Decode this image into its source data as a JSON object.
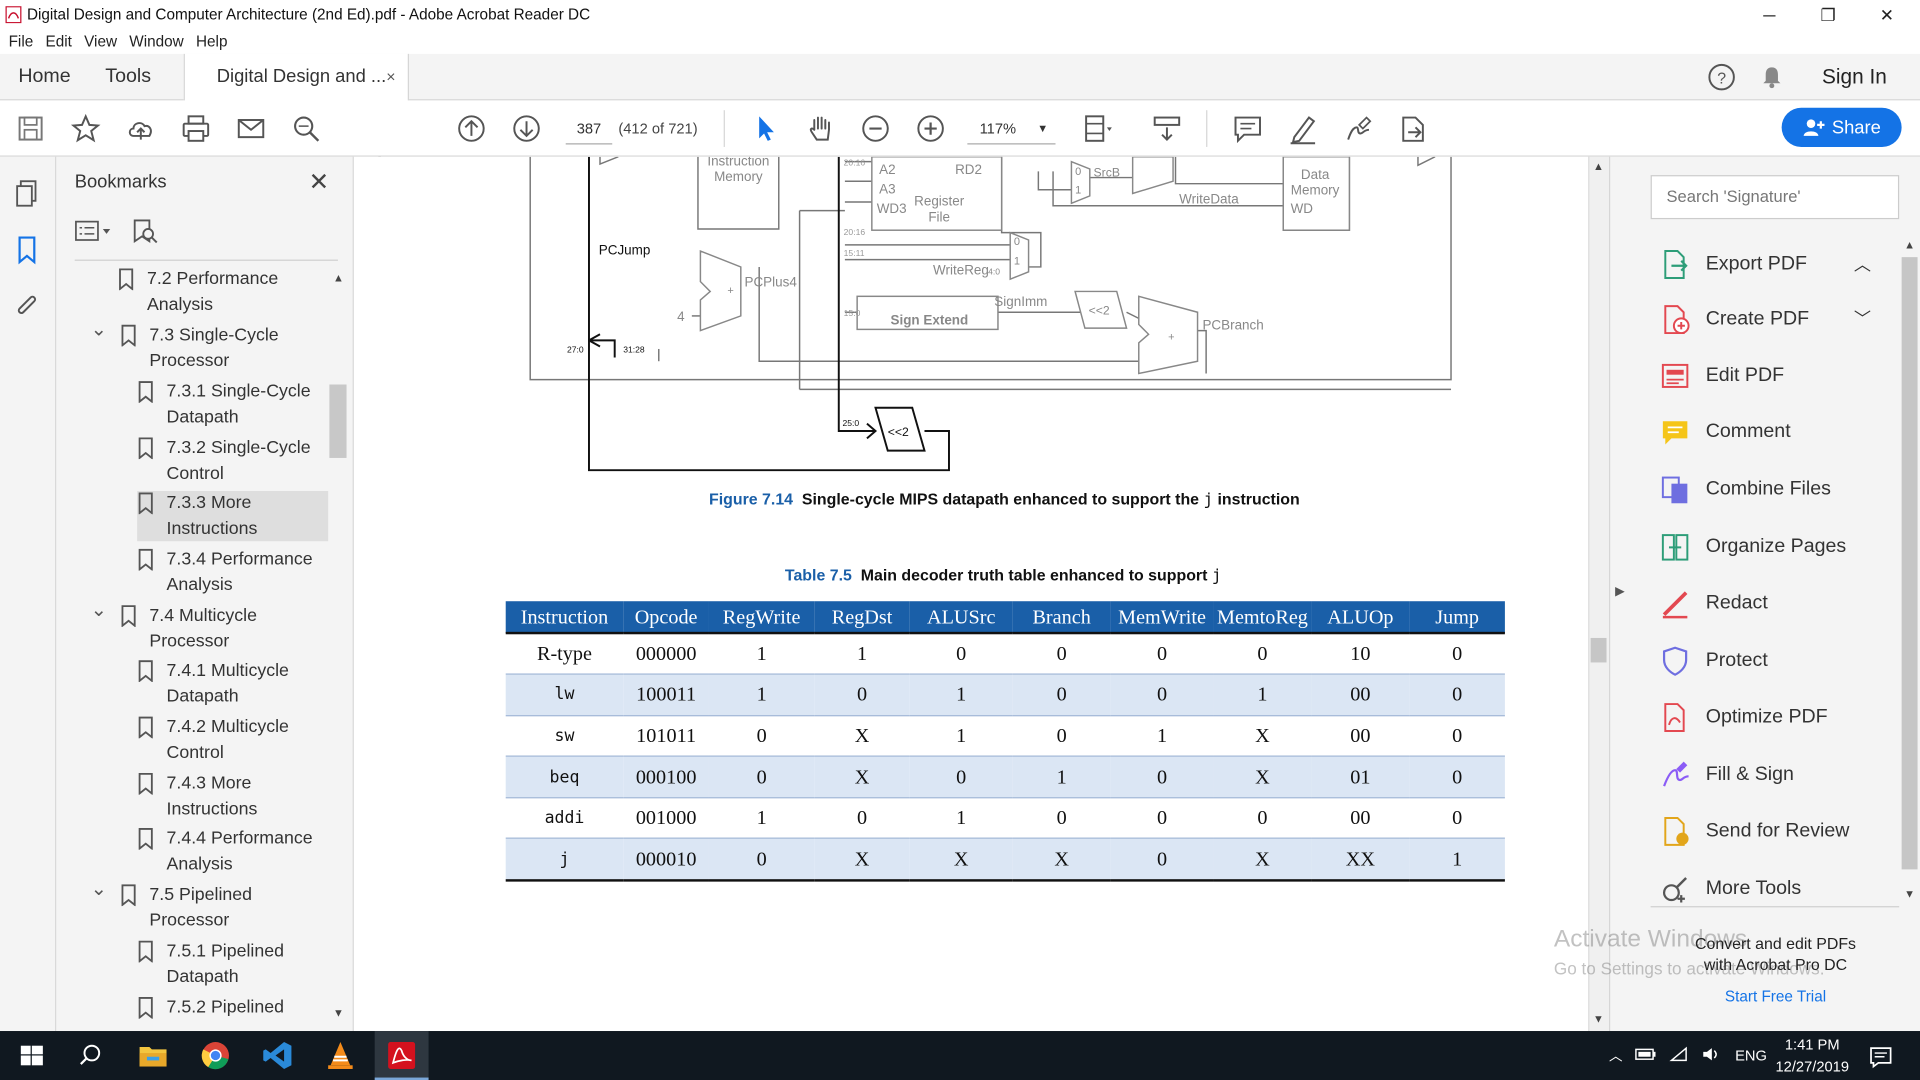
{
  "window": {
    "title": "Digital Design and Computer Architecture (2nd Ed).pdf - Adobe Acrobat Reader DC",
    "minimize": "─",
    "restore": "❐",
    "close": "✕"
  },
  "menu": [
    "File",
    "Edit",
    "View",
    "Window",
    "Help"
  ],
  "tabs": {
    "home": "Home",
    "tools": "Tools",
    "document": "Digital Design and ...",
    "document_close": "×",
    "sign_in": "Sign In"
  },
  "toolbar": {
    "page_number": "387",
    "page_count": "(412 of 721)",
    "zoom": "117%",
    "share_label": "Share"
  },
  "bookmarks": {
    "title": "Bookmarks",
    "close": "✕",
    "items": [
      {
        "label_line1": "7.2 Performance",
        "label_line2": "Analysis"
      },
      {
        "label_line1": "7.3 Single-Cycle",
        "label_line2": "Processor"
      },
      {
        "label_line1": "7.3.1 Single-Cycle",
        "label_line2": "Datapath"
      },
      {
        "label_line1": "7.3.2 Single-Cycle",
        "label_line2": "Control"
      },
      {
        "label_line1": "7.3.3 More",
        "label_line2": "Instructions"
      },
      {
        "label_line1": "7.3.4 Performance",
        "label_line2": "Analysis"
      },
      {
        "label_line1": "7.4 Multicycle",
        "label_line2": "Processor"
      },
      {
        "label_line1": "7.4.1 Multicycle",
        "label_line2": "Datapath"
      },
      {
        "label_line1": "7.4.2 Multicycle",
        "label_line2": "Control"
      },
      {
        "label_line1": "7.4.3 More",
        "label_line2": "Instructions"
      },
      {
        "label_line1": "7.4.4 Performance",
        "label_line2": "Analysis"
      },
      {
        "label_line1": "7.5 Pipelined",
        "label_line2": "Processor"
      },
      {
        "label_line1": "7.5.1 Pipelined",
        "label_line2": "Datapath"
      },
      {
        "label_line1": "7.5.2 Pipelined",
        "label_line2": ""
      }
    ]
  },
  "diagram": {
    "instruction_memory": [
      "Instruction",
      "Memory"
    ],
    "register_file": [
      "Register",
      "File"
    ],
    "data_memory": [
      "Data",
      "Memory"
    ],
    "reg_ports": [
      "A2",
      "A3",
      "WD3"
    ],
    "rd2": "RD2",
    "wd": "WD",
    "srcb": "SrcB",
    "writedata": "WriteData",
    "writereg": "WriteReg",
    "writereg_sub": "4:0",
    "pcplus4": "PCPlus4",
    "pcjump": "PCJump",
    "four": "4",
    "plus": "+",
    "sign_extend": "Sign Extend",
    "signimm": "SignImm",
    "shift_left": "<<2",
    "pcbranch": "PCBranch",
    "bits_20_16": "20:16",
    "bits_15_11": "15:11",
    "bits_15_0": "15:0",
    "bits_27_0": "27:0",
    "bits_31_28": "31:28",
    "bits_25_0": "25:0",
    "mux0": "0",
    "mux1": "1"
  },
  "figure": {
    "label": "Figure 7.14",
    "text": "Single-cycle MIPS datapath enhanced to support the",
    "mono": "j",
    "tail": "instruction"
  },
  "table_caption": {
    "label": "Table 7.5",
    "text": "Main decoder truth table enhanced to support",
    "mono": "j"
  },
  "truth_table": {
    "headers": [
      "Instruction",
      "Opcode",
      "RegWrite",
      "RegDst",
      "ALUSrc",
      "Branch",
      "MemWrite",
      "MemtoReg",
      "ALUOp",
      "Jump"
    ],
    "rows": [
      [
        "R-type",
        "000000",
        "1",
        "1",
        "0",
        "0",
        "0",
        "0",
        "10",
        "0"
      ],
      [
        "lw",
        "100011",
        "1",
        "0",
        "1",
        "0",
        "0",
        "1",
        "00",
        "0"
      ],
      [
        "sw",
        "101011",
        "0",
        "X",
        "1",
        "0",
        "1",
        "X",
        "00",
        "0"
      ],
      [
        "beq",
        "000100",
        "0",
        "X",
        "0",
        "1",
        "0",
        "X",
        "01",
        "0"
      ],
      [
        "addi",
        "001000",
        "1",
        "0",
        "1",
        "0",
        "0",
        "0",
        "00",
        "0"
      ],
      [
        "j",
        "000010",
        "0",
        "X",
        "X",
        "X",
        "0",
        "X",
        "XX",
        "1"
      ]
    ]
  },
  "tools_pane": {
    "search_placeholder": "Search 'Signature'",
    "items": [
      "Export PDF",
      "Create PDF",
      "Edit PDF",
      "Comment",
      "Combine Files",
      "Organize Pages",
      "Redact",
      "Protect",
      "Optimize PDF",
      "Fill & Sign",
      "Send for Review",
      "More Tools"
    ],
    "promo_line1": "Convert and edit PDFs",
    "promo_line2": "with Acrobat Pro DC",
    "promo_link": "Start Free Trial"
  },
  "watermark": {
    "line1": "Activate Windows",
    "line2": "Go to Settings to activate Windows."
  },
  "taskbar": {
    "language": "ENG",
    "time": "1:41 PM",
    "date": "12/27/2019"
  }
}
